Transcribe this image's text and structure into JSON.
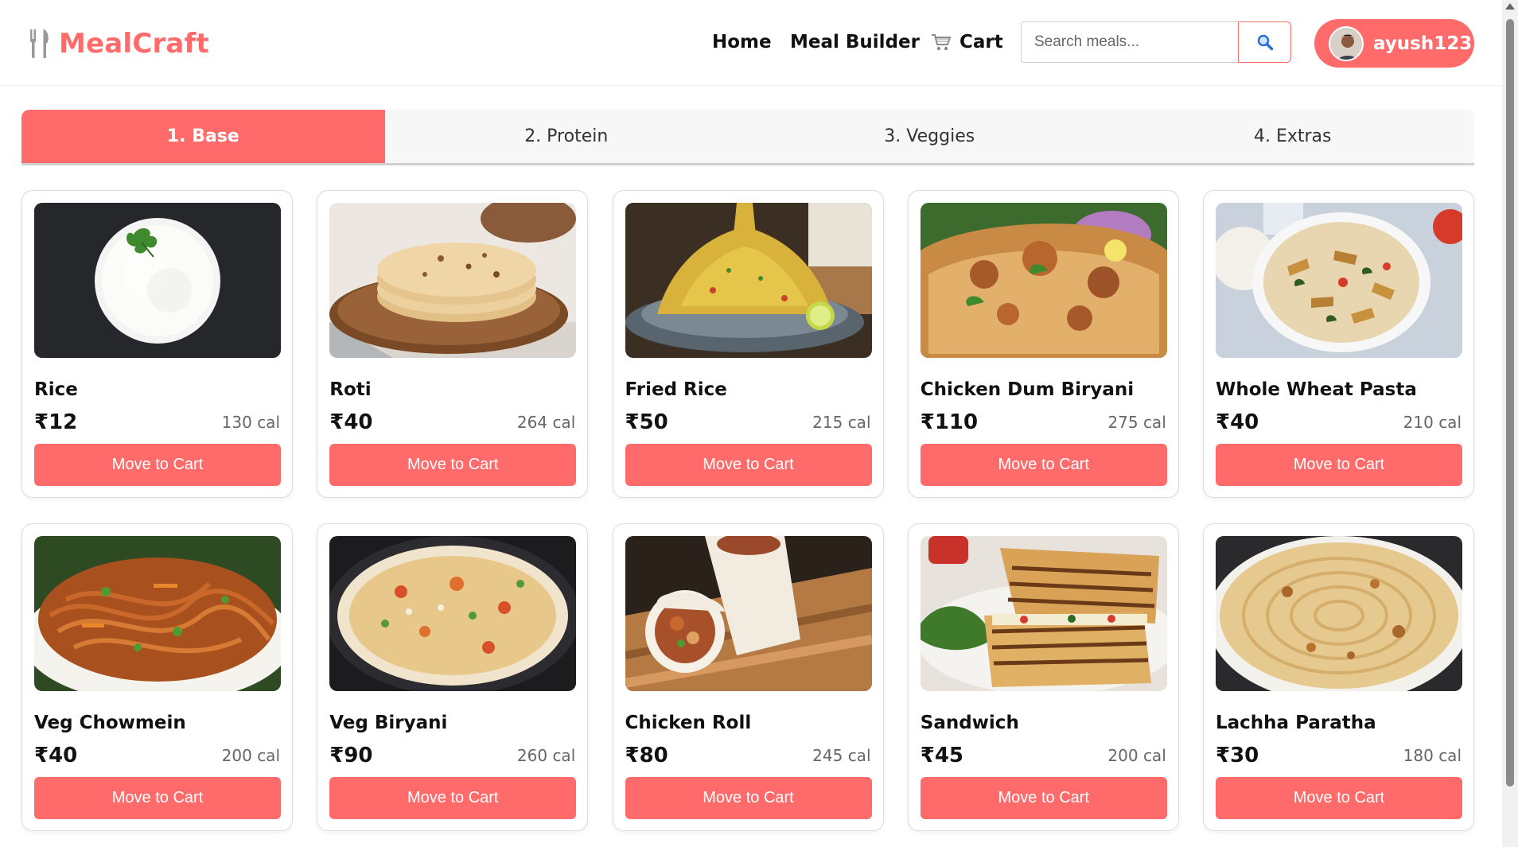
{
  "brand": {
    "name": "MealCraft",
    "color": "#ff6b6b"
  },
  "nav": {
    "home": "Home",
    "meal_builder": "Meal Builder",
    "cart": "Cart"
  },
  "search": {
    "placeholder": "Search meals...",
    "value": ""
  },
  "user": {
    "name": "ayush123"
  },
  "tabs": [
    {
      "label": "1. Base",
      "active": true
    },
    {
      "label": "2. Protein",
      "active": false
    },
    {
      "label": "3. Veggies",
      "active": false
    },
    {
      "label": "4. Extras",
      "active": false
    }
  ],
  "items": [
    {
      "name": "Rice",
      "price": "₹12",
      "calories": "130 cal",
      "button": "Move to Cart",
      "image": "rice-bowl"
    },
    {
      "name": "Roti",
      "price": "₹40",
      "calories": "264 cal",
      "button": "Move to Cart",
      "image": "roti-stack"
    },
    {
      "name": "Fried Rice",
      "price": "₹50",
      "calories": "215 cal",
      "button": "Move to Cart",
      "image": "fried-rice-plate"
    },
    {
      "name": "Chicken Dum Biryani",
      "price": "₹110",
      "calories": "275 cal",
      "button": "Move to Cart",
      "image": "chicken-biryani-plate"
    },
    {
      "name": "Whole Wheat Pasta",
      "price": "₹40",
      "calories": "210 cal",
      "button": "Move to Cart",
      "image": "pasta-bowl"
    },
    {
      "name": "Veg Chowmein",
      "price": "₹40",
      "calories": "200 cal",
      "button": "Move to Cart",
      "image": "chowmein-plate"
    },
    {
      "name": "Veg Biryani",
      "price": "₹90",
      "calories": "260 cal",
      "button": "Move to Cart",
      "image": "veg-biryani-pan"
    },
    {
      "name": "Chicken Roll",
      "price": "₹80",
      "calories": "245 cal",
      "button": "Move to Cart",
      "image": "chicken-roll-board"
    },
    {
      "name": "Sandwich",
      "price": "₹45",
      "calories": "200 cal",
      "button": "Move to Cart",
      "image": "grilled-sandwich"
    },
    {
      "name": "Lachha Paratha",
      "price": "₹30",
      "calories": "180 cal",
      "button": "Move to Cart",
      "image": "lachha-paratha"
    }
  ]
}
